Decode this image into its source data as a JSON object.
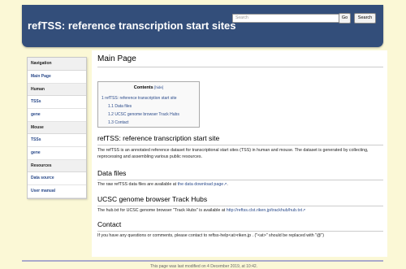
{
  "header": {
    "site_title": "refTSS: reference transcription start sites",
    "search_placeholder": "Search",
    "go_label": "Go",
    "search_label": "Search"
  },
  "sidebar": {
    "sections": [
      {
        "heading": "Navigation",
        "items": [
          "Main Page"
        ]
      },
      {
        "heading": "Human",
        "items": [
          "TSSs",
          "gene"
        ]
      },
      {
        "heading": "Mouse",
        "items": [
          "TSSs",
          "gene"
        ]
      },
      {
        "heading": "Resources",
        "items": [
          "Data source",
          "User manual"
        ]
      }
    ]
  },
  "main": {
    "page_title": "Main Page",
    "toc": {
      "title": "Contents",
      "hide": "[hide]",
      "items": [
        "1 refTSS: reference transcription start site",
        "1.1 Data files",
        "1.2 UCSC genome browser Track Hubs",
        "1.3 Contact"
      ]
    },
    "sections": {
      "intro_heading": "refTSS: reference transcription start site",
      "intro_text": "The refTSS is an annotated reference dataset for transcriptional start sites (TSS) in human and mouse. The dataset is generated by collecting, reprocessing and assembling various public resources.",
      "data_heading": "Data files",
      "data_text": "The raw refTSS data files are available at",
      "data_link": "the data download page",
      "hubs_heading": "UCSC genome browser Track Hubs",
      "hubs_text": "The hub.txt for UCSC genome browser \"Track Hubs\" is available at",
      "hubs_link": "http://reftss.clst.riken.jp/trackhub/hub.txt",
      "contact_heading": "Contact",
      "contact_text": "If you have any questions or comments, please contact to reftss-help<at>riken.jp . (\"<at>\" should be replaced with \"@\")"
    }
  },
  "footer": {
    "text": "This page was last modified on 4 December 2019, at 10:42."
  }
}
